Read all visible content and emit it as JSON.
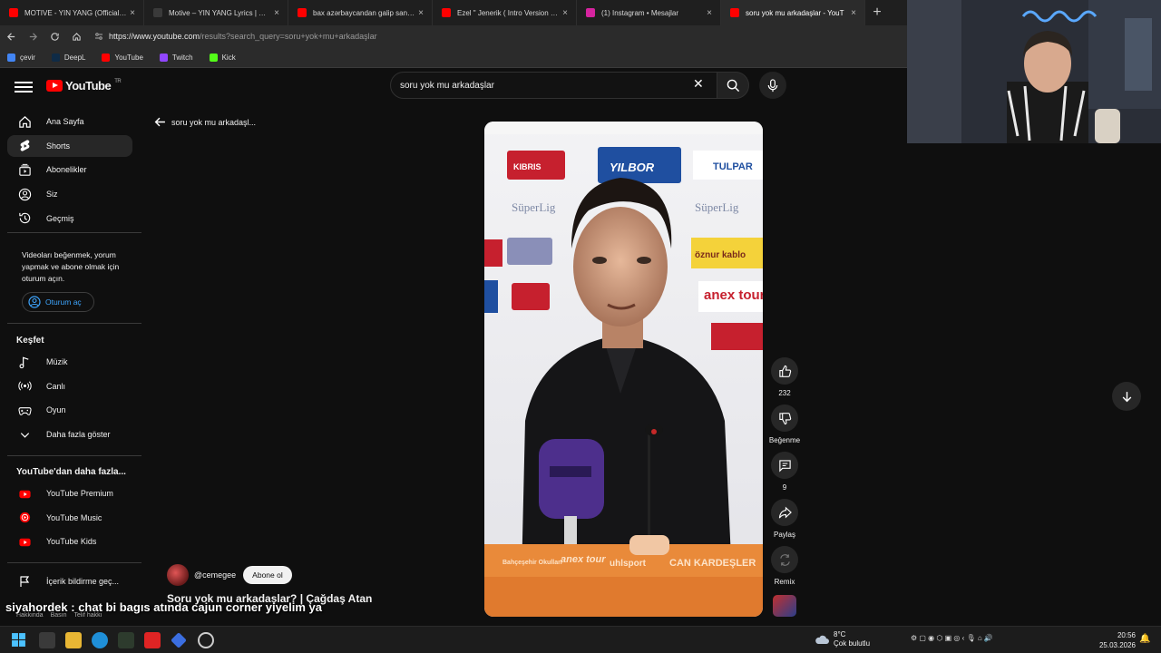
{
  "browser": {
    "tabs": [
      {
        "title": "MOTIVE - YIN YANG (Official Music",
        "favicon_color": "#ff0000",
        "active": false
      },
      {
        "title": "Motive – YIN YANG Lyrics | Genius",
        "favicon_color": "#3a3a3a",
        "active": false
      },
      {
        "title": "bax azərbaycandan galip sani s*q",
        "favicon_color": "#ff0000",
        "active": false
      },
      {
        "title": "Ezel \" Jenerik ( Intro Version ) \" To",
        "favicon_color": "#ff0000",
        "active": false
      },
      {
        "title": "(1) Instagram • Mesajlar",
        "favicon_color": "#d6249f",
        "active": false
      },
      {
        "title": "soru yok mu arkadaşlar - YouT",
        "favicon_color": "#ff0000",
        "active": true
      }
    ],
    "tab_close": "×",
    "new_tab": "+",
    "url_host": "https://www.youtube.com",
    "url_path": "/results?search_query=soru+yok+mu+arkadaşlar",
    "bookmarks": [
      {
        "label": "çevir",
        "color": "#4285f4"
      },
      {
        "label": "DeepL",
        "color": "#0f2b46"
      },
      {
        "label": "YouTube",
        "color": "#ff0000"
      },
      {
        "label": "Twitch",
        "color": "#9146ff"
      },
      {
        "label": "Kick",
        "color": "#53fc18"
      }
    ]
  },
  "youtube": {
    "logo_text": "YouTube",
    "logo_region": "TR",
    "search_value": "soru yok mu arkadaşlar",
    "sidebar": {
      "main": [
        {
          "label": "Ana Sayfa",
          "icon": "home-icon"
        },
        {
          "label": "Shorts",
          "icon": "shorts-icon",
          "active": true
        },
        {
          "label": "Abonelikler",
          "icon": "subscriptions-icon"
        },
        {
          "label": "Siz",
          "icon": "user-icon"
        },
        {
          "label": "Geçmiş",
          "icon": "history-icon"
        }
      ],
      "signin_prompt": "Videoları beğenmek, yorum yapmak ve abone olmak için oturum açın.",
      "signin_button": "Oturum aç",
      "explore_title": "Keşfet",
      "explore": [
        {
          "label": "Müzik",
          "icon": "music-icon"
        },
        {
          "label": "Canlı",
          "icon": "live-icon"
        },
        {
          "label": "Oyun",
          "icon": "gaming-icon"
        },
        {
          "label": "Daha fazla göster",
          "icon": "chevron-down-icon"
        }
      ],
      "more_title": "YouTube'dan daha fazla...",
      "more": [
        {
          "label": "YouTube Premium"
        },
        {
          "label": "YouTube Music"
        },
        {
          "label": "YouTube Kids"
        }
      ],
      "report": "İçerik bildirme geç...",
      "footer": [
        "Hakkında",
        "Basın",
        "Telif hakkı"
      ]
    },
    "back_label": "soru yok mu arkadaşl...",
    "short": {
      "channel": "@cemegee",
      "subscribe": "Abone ol",
      "title": "Soru yok mu arkadaşlar? | Çağdaş Atan",
      "likes": "232",
      "dislike_label": "Beğenme",
      "comments": "9",
      "share_label": "Paylaş",
      "remix_label": "Remix",
      "sponsors_top": [
        "KIBRIS",
        "YILBOR",
        "TULPAR",
        "SüperLig",
        "SüperLig",
        "öznur kablo",
        "anex tour"
      ],
      "desk_logos": [
        "Bahçeşehir Okulları",
        "anex tour",
        "uhlsport",
        "CAN KARDEŞLER"
      ]
    }
  },
  "overlay": {
    "chat_line": "siyahordek : chat bi bagıs atında cajun corner yiyelim ya"
  },
  "taskbar": {
    "weather_temp": "8°C",
    "weather_desc": "Çok bulutlu",
    "time": "20:56",
    "date": "25.03.2026"
  }
}
